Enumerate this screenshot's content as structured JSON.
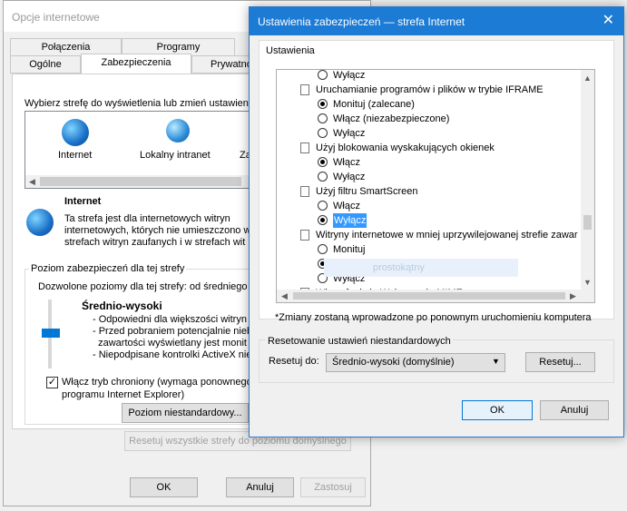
{
  "back_window": {
    "title": "Opcje internetowe",
    "tabs_top": [
      "Połączenia",
      "Programy",
      ""
    ],
    "tabs_bottom": [
      "Ogólne",
      "Zabezpieczenia",
      "Prywatno"
    ],
    "zone_prompt": "Wybierz strefę do wyświetlenia lub zmień ustawienia",
    "zones": [
      "Internet",
      "Lokalny intranet",
      "Za"
    ],
    "zone_title": "Internet",
    "zone_desc": [
      "Ta strefa jest dla internetowych witryn",
      "internetowych, których nie umieszczono w",
      "strefach witryn zaufanych i w strefach wit"
    ],
    "level_group_label": "Poziom zabezpieczeń dla tej strefy",
    "allowed_levels": "Dozwolone poziomy dla tej strefy: od średniego",
    "level_name": "Średnio-wysoki",
    "level_points": [
      "- Odpowiedni dla większości witryn in",
      "- Przed pobraniem potencjalnie niebe",
      "  zawartości wyświetlany jest monit",
      "- Niepodpisane kontrolki ActiveX nie"
    ],
    "protected_mode": "Włącz tryb chroniony (wymaga ponownego",
    "protected_mode_2": "programu Internet Explorer)",
    "custom_level_button": "Poziom niestandardowy...",
    "reset_all_button": "Resetuj wszystkie strefy do poziomu domyślnego",
    "ok": "OK",
    "cancel": "Anuluj",
    "apply": "Zastosuj"
  },
  "front_window": {
    "title": "Ustawienia zabezpieczeń — strefa Internet",
    "close_glyph": "✕",
    "settings_label": "Ustawienia",
    "settings_rows": [
      {
        "kind": "radio",
        "label": "Wyłącz",
        "checked": false
      },
      {
        "kind": "header",
        "label": "Uruchamianie programów i plików w trybie IFRAME"
      },
      {
        "kind": "radio",
        "label": "Monituj (zalecane)",
        "checked": true
      },
      {
        "kind": "radio",
        "label": "Włącz (niezabezpieczone)",
        "checked": false
      },
      {
        "kind": "radio",
        "label": "Wyłącz",
        "checked": false
      },
      {
        "kind": "header",
        "label": "Użyj blokowania wyskakujących okienek"
      },
      {
        "kind": "radio",
        "label": "Włącz",
        "checked": true
      },
      {
        "kind": "radio",
        "label": "Wyłącz",
        "checked": false
      },
      {
        "kind": "header",
        "label": "Użyj filtru SmartScreen"
      },
      {
        "kind": "radio",
        "label": "Włącz",
        "checked": false
      },
      {
        "kind": "radio",
        "label": "Wyłącz",
        "checked": true,
        "selected": true
      },
      {
        "kind": "header",
        "label": "Witryny internetowe w mniej uprzywilejowanej strefie zawar"
      },
      {
        "kind": "radio",
        "label": "Monituj",
        "checked": false
      },
      {
        "kind": "radio",
        "label": "Włącz",
        "checked": true
      },
      {
        "kind": "radio",
        "label": "Wyłącz",
        "checked": false
      },
      {
        "kind": "header",
        "label": "Włącz funkcję Wykrywanie MIME"
      }
    ],
    "ghost_text": "prostokątny",
    "restart_note": "*Zmiany zostaną wprowadzone po ponownym uruchomieniu komputera",
    "reset_group_label": "Resetowanie ustawień niestandardowych",
    "reset_to_label": "Resetuj do:",
    "reset_to_value": "Średnio-wysoki (domyślnie)",
    "reset_button": "Resetuj...",
    "ok": "OK",
    "cancel": "Anuluj"
  },
  "colors": {
    "title_bar": "#1c7bd4",
    "selection": "#3399ff"
  }
}
